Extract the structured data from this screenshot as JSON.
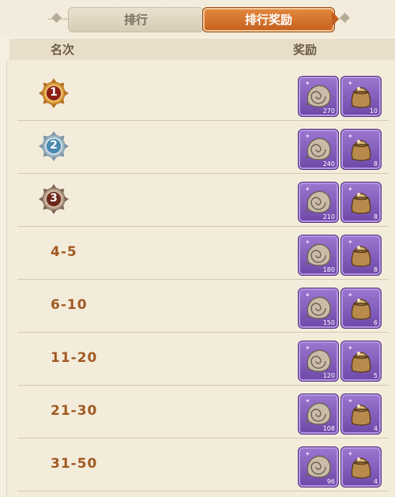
{
  "tabs": [
    {
      "label": "排行",
      "active": false
    },
    {
      "label": "排行奖励",
      "active": true
    }
  ],
  "header": {
    "rank_col": "名次",
    "reward_col": "奖励"
  },
  "colors": {
    "accent": "#c8621f",
    "rank_text": "#a05a22",
    "item_bg": "#7f58b8"
  },
  "rows": [
    {
      "rank": "1",
      "type": "medal-gold",
      "shell_icon": "shell-icon",
      "shell_count": "270",
      "bag_icon": "bag-icon",
      "bag_count": "10"
    },
    {
      "rank": "2",
      "type": "medal-silver",
      "shell_icon": "shell-icon",
      "shell_count": "240",
      "bag_icon": "bag-icon",
      "bag_count": "8"
    },
    {
      "rank": "3",
      "type": "medal-bronze",
      "shell_icon": "shell-icon",
      "shell_count": "210",
      "bag_icon": "bag-icon",
      "bag_count": "8"
    },
    {
      "rank": "4-5",
      "type": "text",
      "shell_icon": "shell-icon",
      "shell_count": "180",
      "bag_icon": "bag-icon",
      "bag_count": "8"
    },
    {
      "rank": "6-10",
      "type": "text",
      "shell_icon": "shell-icon",
      "shell_count": "150",
      "bag_icon": "bag-icon",
      "bag_count": "6"
    },
    {
      "rank": "11-20",
      "type": "text",
      "shell_icon": "shell-icon",
      "shell_count": "120",
      "bag_icon": "bag-icon",
      "bag_count": "5"
    },
    {
      "rank": "21-30",
      "type": "text",
      "shell_icon": "shell-icon",
      "shell_count": "108",
      "bag_icon": "bag-icon",
      "bag_count": "4"
    },
    {
      "rank": "31-50",
      "type": "text",
      "shell_icon": "shell-icon",
      "shell_count": "96",
      "bag_icon": "bag-icon",
      "bag_count": "4"
    }
  ]
}
